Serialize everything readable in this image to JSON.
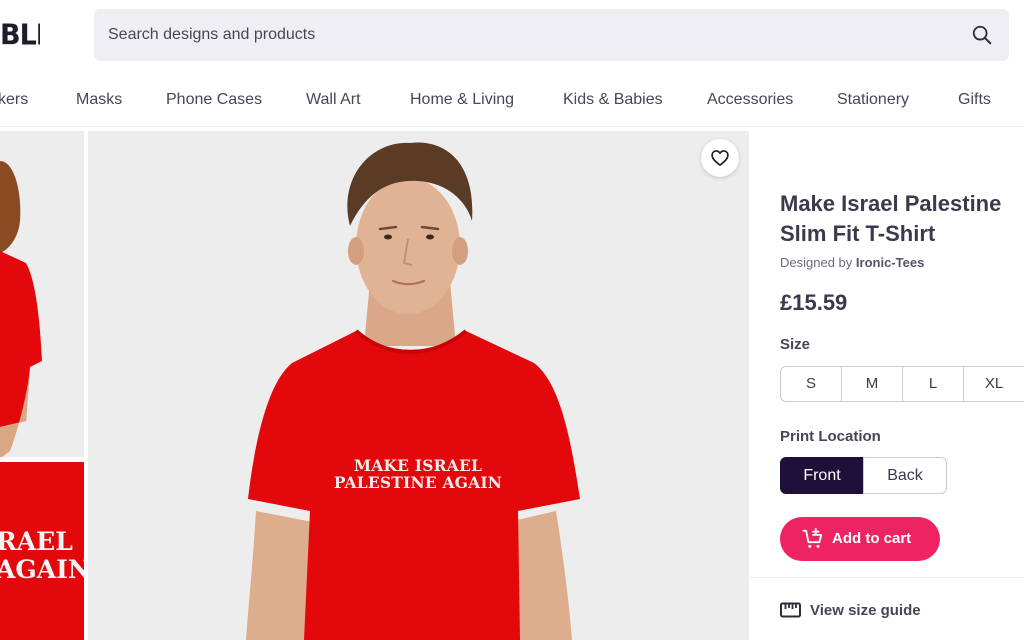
{
  "header": {
    "logo_text": "BLE",
    "search_placeholder": "Search designs and products",
    "search_icon": "search-icon"
  },
  "nav": {
    "items": [
      "kers",
      "Masks",
      "Phone Cases",
      "Wall Art",
      "Home & Living",
      "Kids & Babies",
      "Accessories",
      "Stationery",
      "Gifts"
    ]
  },
  "gallery": {
    "thumb_text": [
      "RAEL",
      "AGAIN"
    ],
    "shirt_text": [
      "MAKE ISRAEL",
      "PALESTINE AGAIN"
    ],
    "favorite_icon": "heart-icon"
  },
  "product": {
    "title_line1": "Make Israel Palestine",
    "title_line2": "Slim Fit T-Shirt",
    "designed_by_label": "Designed by",
    "designer": "Ironic-Tees",
    "price": "£15.59",
    "size_label": "Size",
    "sizes": [
      "S",
      "M",
      "L",
      "XL"
    ],
    "print_location_label": "Print Location",
    "print_locations": [
      "Front",
      "Back"
    ],
    "selected_print_location": "Front",
    "add_to_cart_label": "Add to cart",
    "add_to_cart_icon": "cart-plus-icon",
    "size_guide_label": "View size guide",
    "size_guide_icon": "ruler-icon"
  },
  "colors": {
    "accent": "#ee2462",
    "selected": "#1e1038",
    "shirt": "#e3080c"
  }
}
